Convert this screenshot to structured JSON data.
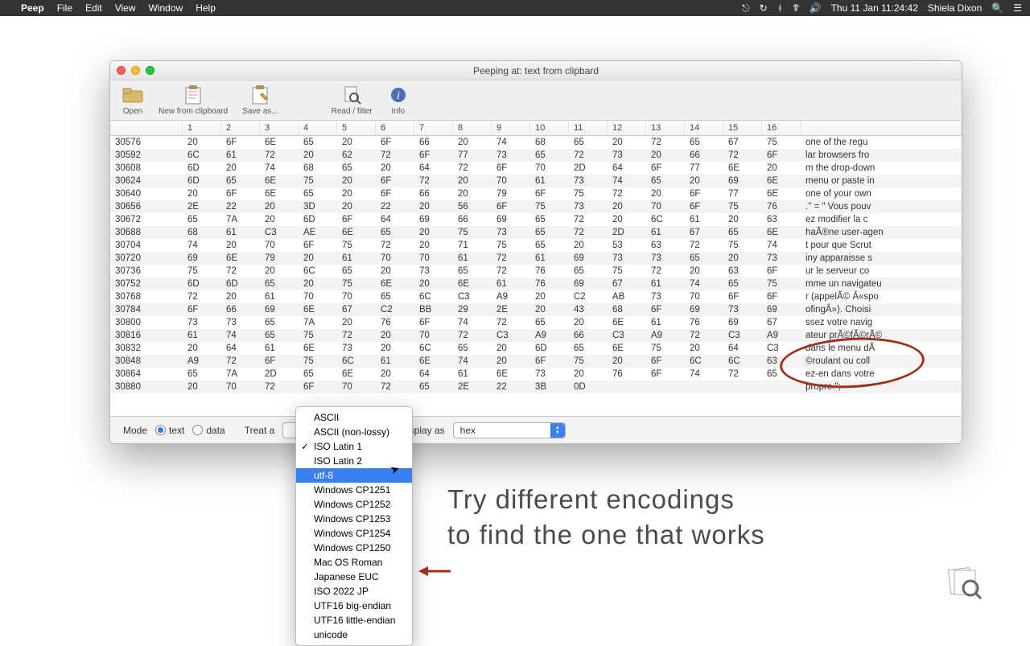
{
  "menubar": {
    "app": "Peep",
    "items": [
      "File",
      "Edit",
      "View",
      "Window",
      "Help"
    ],
    "clock": "Thu 11 Jan  11:24:42",
    "user": "Shiela Dixon"
  },
  "window": {
    "title": "Peeping at: text from clipbard",
    "toolbar": {
      "open": "Open",
      "new_clipboard": "New from clipboard",
      "save_as": "Save as...",
      "read_filter": "Read / filter",
      "info": "Info"
    }
  },
  "table": {
    "columns": [
      "",
      "1",
      "2",
      "3",
      "4",
      "5",
      "6",
      "7",
      "8",
      "9",
      "10",
      "11",
      "12",
      "13",
      "14",
      "15",
      "16",
      ""
    ],
    "rows": [
      {
        "offset": "30576",
        "hex": [
          "20",
          "6F",
          "6E",
          "65",
          "20",
          "6F",
          "66",
          "20",
          "74",
          "68",
          "65",
          "20",
          "72",
          "65",
          "67",
          "75"
        ],
        "text": " one of the regu"
      },
      {
        "offset": "30592",
        "hex": [
          "6C",
          "61",
          "72",
          "20",
          "62",
          "72",
          "6F",
          "77",
          "73",
          "65",
          "72",
          "73",
          "20",
          "66",
          "72",
          "6F"
        ],
        "text": "lar browsers fro"
      },
      {
        "offset": "30608",
        "hex": [
          "6D",
          "20",
          "74",
          "68",
          "65",
          "20",
          "64",
          "72",
          "6F",
          "70",
          "2D",
          "64",
          "6F",
          "77",
          "6E",
          "20"
        ],
        "text": "m the drop-down "
      },
      {
        "offset": "30624",
        "hex": [
          "6D",
          "65",
          "6E",
          "75",
          "20",
          "6F",
          "72",
          "20",
          "70",
          "61",
          "73",
          "74",
          "65",
          "20",
          "69",
          "6E"
        ],
        "text": "menu or paste in"
      },
      {
        "offset": "30640",
        "hex": [
          "20",
          "6F",
          "6E",
          "65",
          "20",
          "6F",
          "66",
          "20",
          "79",
          "6F",
          "75",
          "72",
          "20",
          "6F",
          "77",
          "6E"
        ],
        "text": " one of your own"
      },
      {
        "offset": "30656",
        "hex": [
          "2E",
          "22",
          "20",
          "3D",
          "20",
          "22",
          "20",
          "56",
          "6F",
          "75",
          "73",
          "20",
          "70",
          "6F",
          "75",
          "76"
        ],
        "text": ".\" = \" Vous pouv"
      },
      {
        "offset": "30672",
        "hex": [
          "65",
          "7A",
          "20",
          "6D",
          "6F",
          "64",
          "69",
          "66",
          "69",
          "65",
          "72",
          "20",
          "6C",
          "61",
          "20",
          "63"
        ],
        "text": "ez modifier la c"
      },
      {
        "offset": "30688",
        "hex": [
          "68",
          "61",
          "C3",
          "AE",
          "6E",
          "65",
          "20",
          "75",
          "73",
          "65",
          "72",
          "2D",
          "61",
          "67",
          "65",
          "6E"
        ],
        "text": "haÃ®ne user-agen"
      },
      {
        "offset": "30704",
        "hex": [
          "74",
          "20",
          "70",
          "6F",
          "75",
          "72",
          "20",
          "71",
          "75",
          "65",
          "20",
          "53",
          "63",
          "72",
          "75",
          "74"
        ],
        "text": "t pour que Scrut"
      },
      {
        "offset": "30720",
        "hex": [
          "69",
          "6E",
          "79",
          "20",
          "61",
          "70",
          "70",
          "61",
          "72",
          "61",
          "69",
          "73",
          "73",
          "65",
          "20",
          "73"
        ],
        "text": "iny apparaisse s"
      },
      {
        "offset": "30736",
        "hex": [
          "75",
          "72",
          "20",
          "6C",
          "65",
          "20",
          "73",
          "65",
          "72",
          "76",
          "65",
          "75",
          "72",
          "20",
          "63",
          "6F"
        ],
        "text": "ur le serveur co"
      },
      {
        "offset": "30752",
        "hex": [
          "6D",
          "6D",
          "65",
          "20",
          "75",
          "6E",
          "20",
          "6E",
          "61",
          "76",
          "69",
          "67",
          "61",
          "74",
          "65",
          "75"
        ],
        "text": "mme un navigateu"
      },
      {
        "offset": "30768",
        "hex": [
          "72",
          "20",
          "61",
          "70",
          "70",
          "65",
          "6C",
          "C3",
          "A9",
          "20",
          "C2",
          "AB",
          "73",
          "70",
          "6F",
          "6F"
        ],
        "text": "r (appelÃ© Â«spo"
      },
      {
        "offset": "30784",
        "hex": [
          "6F",
          "66",
          "69",
          "6E",
          "67",
          "C2",
          "BB",
          "29",
          "2E",
          "20",
          "43",
          "68",
          "6F",
          "69",
          "73",
          "69"
        ],
        "text": "ofingÂ»). Choisi"
      },
      {
        "offset": "30800",
        "hex": [
          "73",
          "73",
          "65",
          "7A",
          "20",
          "76",
          "6F",
          "74",
          "72",
          "65",
          "20",
          "6E",
          "61",
          "76",
          "69",
          "67"
        ],
        "text": "ssez votre navig"
      },
      {
        "offset": "30816",
        "hex": [
          "61",
          "74",
          "65",
          "75",
          "72",
          "20",
          "70",
          "72",
          "C3",
          "A9",
          "66",
          "C3",
          "A9",
          "72",
          "C3",
          "A9"
        ],
        "text": "ateur prÃ©fÃ©rÃ©"
      },
      {
        "offset": "30832",
        "hex": [
          "20",
          "64",
          "61",
          "6E",
          "73",
          "20",
          "6C",
          "65",
          "20",
          "6D",
          "65",
          "6E",
          "75",
          "20",
          "64",
          "C3"
        ],
        "text": " dans le menu dÃ"
      },
      {
        "offset": "30848",
        "hex": [
          "A9",
          "72",
          "6F",
          "75",
          "6C",
          "61",
          "6E",
          "74",
          "20",
          "6F",
          "75",
          "20",
          "6F",
          "6C",
          "6C",
          "63"
        ],
        "text": "©roulant ou coll"
      },
      {
        "offset": "30864",
        "hex": [
          "65",
          "7A",
          "2D",
          "65",
          "6E",
          "20",
          "64",
          "61",
          "6E",
          "73",
          "20",
          "76",
          "6F",
          "74",
          "72",
          "65"
        ],
        "text": "ez-en dans votre"
      },
      {
        "offset": "30880",
        "hex": [
          "20",
          "70",
          "72",
          "6F",
          "70",
          "72",
          "65",
          "2E",
          "22",
          "3B",
          "0D",
          "",
          "",
          "",
          "",
          ""
        ],
        "text": " propre.\";"
      }
    ]
  },
  "bottombar": {
    "mode_label": "Mode",
    "mode_text": "text",
    "mode_data": "data",
    "treat_as_label": "Treat a",
    "display_as_label": "Display as",
    "display_as_value": "hex"
  },
  "dropdown": {
    "items": [
      "ASCII",
      "ASCII (non-lossy)",
      "ISO Latin 1",
      "ISO Latin 2",
      "utf-8",
      "Windows CP1251",
      "Windows CP1252",
      "Windows CP1253",
      "Windows CP1254",
      "Windows CP1250",
      "Mac OS Roman",
      "Japanese EUC",
      "ISO 2022 JP",
      "UTF16 big-endian",
      "UTF16 little-endian",
      "unicode"
    ],
    "checked_index": 2,
    "highlight_index": 4
  },
  "annotation": {
    "line1": "Try different encodings",
    "line2": "to find the one that works"
  }
}
